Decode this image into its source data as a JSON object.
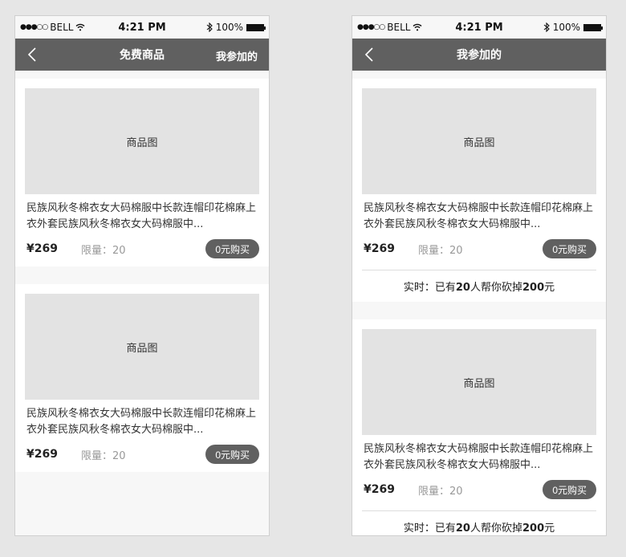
{
  "status": {
    "carrier": "BELL",
    "time": "4:21 PM",
    "battery": "100%"
  },
  "left": {
    "nav_title": "免费商品",
    "nav_right": "我参加的",
    "items": [
      {
        "image_label": "商品图",
        "title": "民族风秋冬棉衣女大码棉服中长款连帽印花棉麻上衣外套民族风秋冬棉衣女大码棉服中...",
        "price": "¥269",
        "limit": "限量：20",
        "buy": "0元购买"
      },
      {
        "image_label": "商品图",
        "title": "民族风秋冬棉衣女大码棉服中长款连帽印花棉麻上衣外套民族风秋冬棉衣女大码棉服中...",
        "price": "¥269",
        "limit": "限量：20",
        "buy": "0元购买"
      }
    ]
  },
  "right": {
    "nav_title": "我参加的",
    "items": [
      {
        "image_label": "商品图",
        "title": "民族风秋冬棉衣女大码棉服中长款连帽印花棉麻上衣外套民族风秋冬棉衣女大码棉服中...",
        "price": "¥269",
        "limit": "限量：20",
        "buy": "0元购买",
        "rt_prefix": "实时：已有",
        "rt_count": "20",
        "rt_mid": "人帮你砍掉",
        "rt_amount": "200",
        "rt_suffix": "元"
      },
      {
        "image_label": "商品图",
        "title": "民族风秋冬棉衣女大码棉服中长款连帽印花棉麻上衣外套民族风秋冬棉衣女大码棉服中...",
        "price": "¥269",
        "limit": "限量：20",
        "buy": "0元购买",
        "rt_prefix": "实时：已有",
        "rt_count": "20",
        "rt_mid": "人帮你砍掉",
        "rt_amount": "200",
        "rt_suffix": "元"
      }
    ]
  },
  "colors": {
    "navbar": "#606060",
    "image_placeholder": "#e3e3e3"
  },
  "icons": {
    "back": "chevron-left-icon",
    "wifi": "wifi-icon",
    "bluetooth": "bluetooth-icon",
    "battery": "battery-icon"
  }
}
